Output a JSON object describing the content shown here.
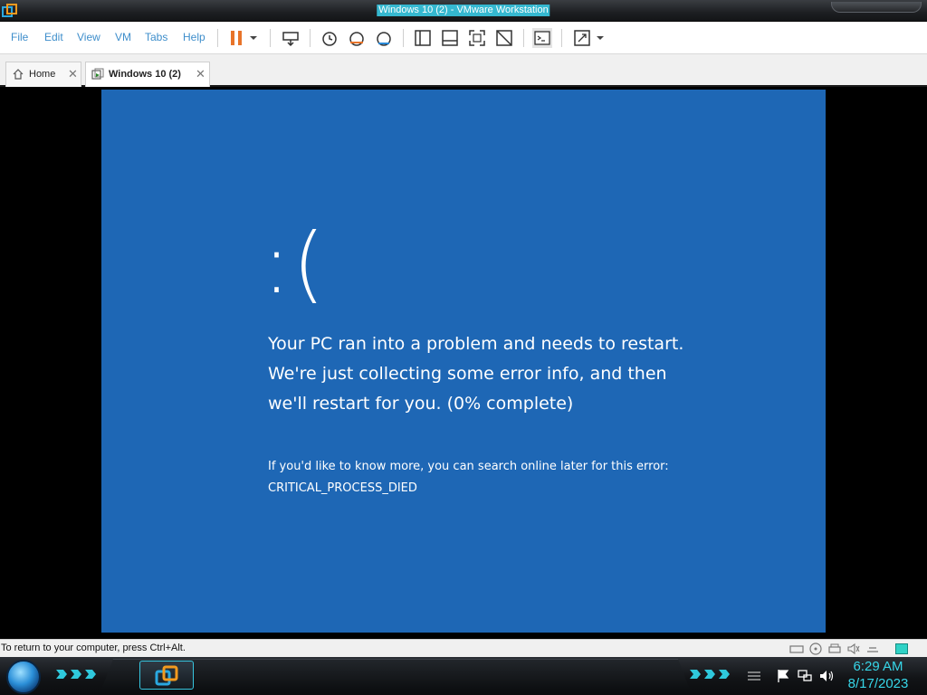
{
  "window": {
    "title": "Windows 10 (2) - VMware Workstation"
  },
  "menu": {
    "items": [
      "File",
      "Edit",
      "View",
      "VM",
      "Tabs",
      "Help"
    ]
  },
  "toolbar": {
    "icons": [
      "pause-icon",
      "dropdown-arrow-icon",
      "send-keys-icon",
      "snapshot-icon",
      "revert-snapshot-icon",
      "snapshot-manager-icon",
      "library-view-icon",
      "thumbnail-bar-icon",
      "fullscreen-icon",
      "unity-icon",
      "console-view-icon",
      "stretch-guest-icon",
      "dropdown-arrow-icon"
    ],
    "accent": "#e8742a"
  },
  "tabs": [
    {
      "label": "Home",
      "icon": "home-icon",
      "active": false
    },
    {
      "label": "Windows 10 (2)",
      "icon": "vm-icon",
      "active": true
    }
  ],
  "bsod": {
    "face": ":(",
    "message": "Your PC ran into a problem and needs to restart. We're just collecting some error info, and then we'll restart for you. (0% complete)",
    "more_info": "If you'd like to know more, you can search online later for this error:",
    "stop_code": "CRITICAL_PROCESS_DIED",
    "background_color": "#1e67b5"
  },
  "statusbar": {
    "text": "To return to your computer, press Ctrl+Alt."
  },
  "taskbar": {
    "time": "6:29 AM",
    "date": "8/17/2023",
    "accent": "#37d6e8"
  }
}
